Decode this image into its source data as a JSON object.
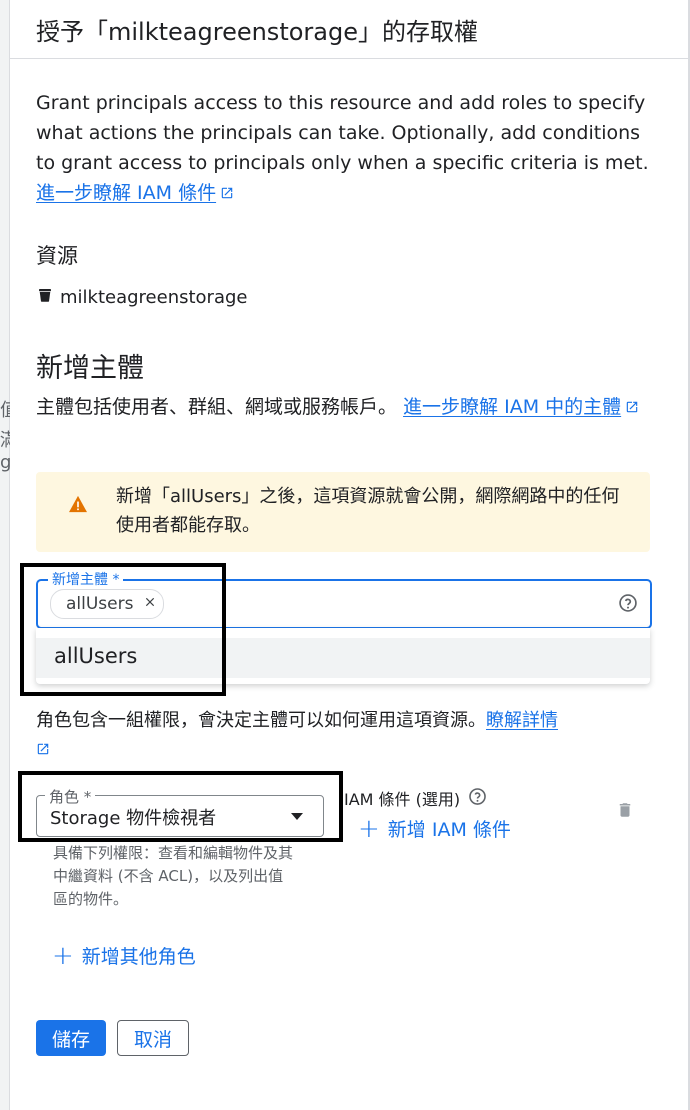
{
  "header": {
    "title": "授予「milkteagreenstorage」的存取權"
  },
  "intro": {
    "text": "Grant principals access to this resource and add roles to specify what actions the principals can take. Optionally, add conditions to grant access to principals only when a specific criteria is met. ",
    "link": "進一步瞭解 IAM 條件"
  },
  "resource": {
    "label": "資源",
    "name": "milkteagreenstorage"
  },
  "add_principals": {
    "title": "新增主體",
    "desc": "主體包括使用者、群組、網域或服務帳戶。 ",
    "link": "進一步瞭解 IAM 中的主體"
  },
  "warning": {
    "text": "新增「allUsers」之後，這項資源就會公開，網際網路中的任何使用者都能存取。"
  },
  "principal_field": {
    "label": "新增主體 *",
    "chip": "allUsers"
  },
  "dropdown": {
    "item": "allUsers"
  },
  "roles": {
    "desc": "角色包含一組權限，會決定主體可以如何運用這項資源。",
    "link": "瞭解詳情"
  },
  "role_select": {
    "label": "角色 *",
    "value": "Storage 物件檢視者",
    "helper": "具備下列權限：查看和編輯物件及其中繼資料 (不含 ACL)，以及列出值區的物件。"
  },
  "iam_condition": {
    "label": "IAM 條件 (選用)",
    "add_button": "新增 IAM 條件"
  },
  "add_role_button": "新增其他角色",
  "buttons": {
    "save": "儲存",
    "cancel": "取消"
  },
  "left_strip_chars": [
    "值",
    "滿",
    "g"
  ],
  "colors": {
    "accent": "#1a73e8",
    "warning_bg": "#fef7e0",
    "warning_icon": "#e37400"
  }
}
